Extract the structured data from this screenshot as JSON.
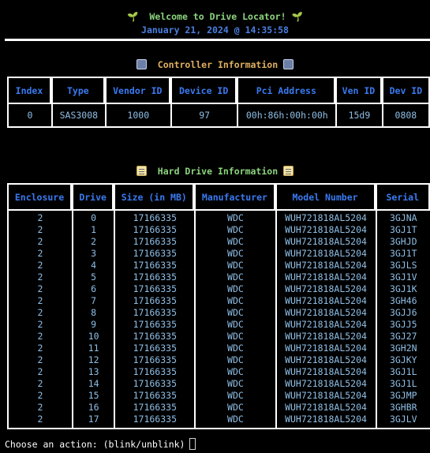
{
  "header": {
    "welcome": "Welcome to Drive Locator!",
    "datetime": "January 21, 2024 @ 14:35:58"
  },
  "controller": {
    "title": "Controller Information",
    "columns": [
      "Index",
      "Type",
      "Vendor ID",
      "Device ID",
      "Pci Address",
      "Ven ID",
      "Dev ID"
    ],
    "rows": [
      [
        "0",
        "SAS3008",
        "1000",
        "97",
        "00h:86h:00h:00h",
        "15d9",
        "0808"
      ]
    ]
  },
  "drives": {
    "title": "Hard Drive Information",
    "columns": [
      "Enclosure",
      "Drive",
      "Size (in MB)",
      "Manufacturer",
      "Model Number",
      "Serial"
    ],
    "rows": [
      [
        "2",
        "0",
        "17166335",
        "WDC",
        "WUH721818AL5204",
        "3GJNA"
      ],
      [
        "2",
        "1",
        "17166335",
        "WDC",
        "WUH721818AL5204",
        "3GJ1T"
      ],
      [
        "2",
        "2",
        "17166335",
        "WDC",
        "WUH721818AL5204",
        "3GHJD"
      ],
      [
        "2",
        "3",
        "17166335",
        "WDC",
        "WUH721818AL5204",
        "3GJ1T"
      ],
      [
        "2",
        "4",
        "17166335",
        "WDC",
        "WUH721818AL5204",
        "3GJLS"
      ],
      [
        "2",
        "5",
        "17166335",
        "WDC",
        "WUH721818AL5204",
        "3GJ1V"
      ],
      [
        "2",
        "6",
        "17166335",
        "WDC",
        "WUH721818AL5204",
        "3GJ1K"
      ],
      [
        "2",
        "7",
        "17166335",
        "WDC",
        "WUH721818AL5204",
        "3GH46"
      ],
      [
        "2",
        "8",
        "17166335",
        "WDC",
        "WUH721818AL5204",
        "3GJJ6"
      ],
      [
        "2",
        "9",
        "17166335",
        "WDC",
        "WUH721818AL5204",
        "3GJJ5"
      ],
      [
        "2",
        "10",
        "17166335",
        "WDC",
        "WUH721818AL5204",
        "3GJ27"
      ],
      [
        "2",
        "11",
        "17166335",
        "WDC",
        "WUH721818AL5204",
        "3GH2N"
      ],
      [
        "2",
        "12",
        "17166335",
        "WDC",
        "WUH721818AL5204",
        "3GJKY"
      ],
      [
        "2",
        "13",
        "17166335",
        "WDC",
        "WUH721818AL5204",
        "3GJ1L"
      ],
      [
        "2",
        "14",
        "17166335",
        "WDC",
        "WUH721818AL5204",
        "3GJ1L"
      ],
      [
        "2",
        "15",
        "17166335",
        "WDC",
        "WUH721818AL5204",
        "3GJMP"
      ],
      [
        "2",
        "16",
        "17166335",
        "WDC",
        "WUH721818AL5204",
        "3GHBR"
      ],
      [
        "2",
        "17",
        "17166335",
        "WDC",
        "WUH721818AL5204",
        "3GJLV"
      ]
    ]
  },
  "prompt": {
    "text": "Choose an action: (blink/unblink)"
  },
  "icons": {
    "header": "sprout-icon",
    "controller": "control-knobs-icon",
    "drives": "memo-icon"
  },
  "colors": {
    "background": "#000000",
    "welcome": "#8cd47e",
    "datetime": "#4a7fe0",
    "controller_title": "#e0b060",
    "drives_title": "#8cd47e",
    "table_header": "#3a7af0",
    "table_cell": "#8fbfe6",
    "border": "#ffffff"
  }
}
